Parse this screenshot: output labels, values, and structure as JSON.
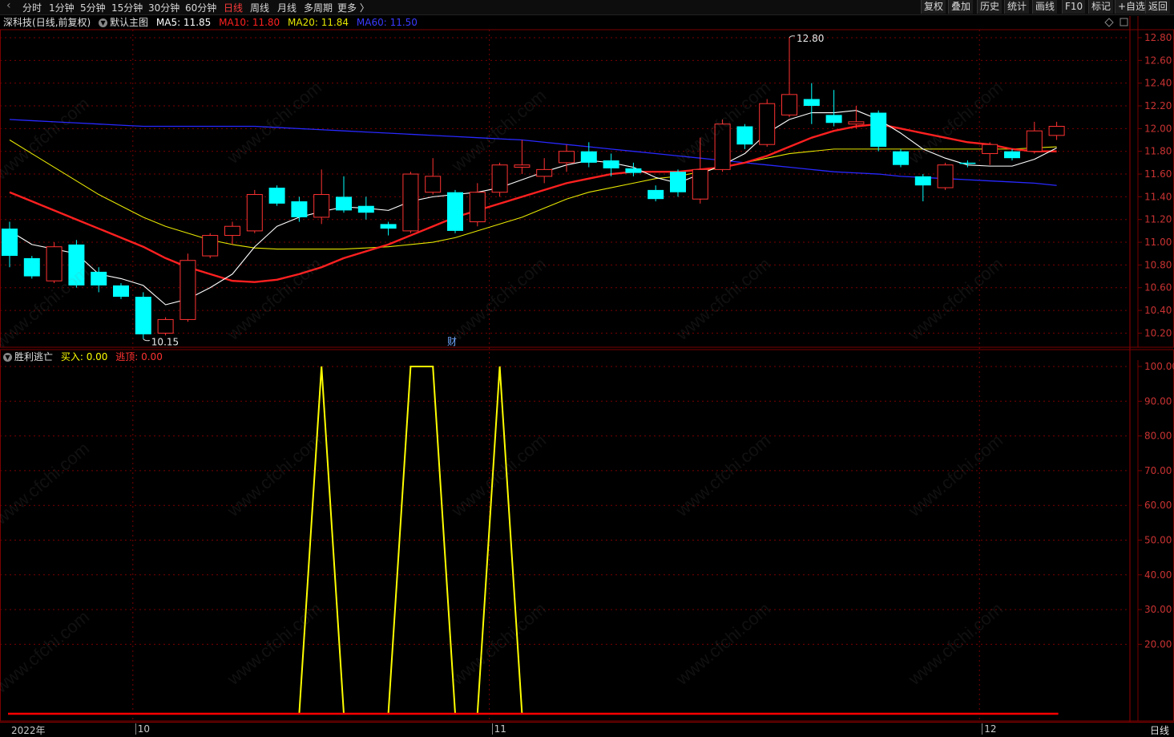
{
  "toolbar": {
    "periods": [
      "分时",
      "1分钟",
      "5分钟",
      "15分钟",
      "30分钟",
      "60分钟",
      "日线",
      "周线",
      "月线",
      "多周期",
      "更多 〉"
    ],
    "active_period": "日线",
    "buttons": [
      "复权",
      "叠加",
      "历史",
      "统计",
      "画线",
      "F10",
      "标记",
      "+自选",
      "返回"
    ]
  },
  "main_info": {
    "stock_name": "深科技",
    "mode": "(日线,前复权)",
    "indicator_name": "默认主图",
    "ma5": "MA5: 11.85",
    "ma10": "MA10: 11.80",
    "ma20": "MA20: 11.84",
    "ma60": "MA60: 11.50"
  },
  "sub_info": {
    "indicator_name": "胜利逃亡",
    "buy": "买入: 0.00",
    "escape": "逃顶: 0.00"
  },
  "colors": {
    "up": "#ff3232",
    "down": "#00ffff",
    "ma5": "#ffffff",
    "ma10": "#ff2020",
    "ma20": "#e6e600",
    "ma60": "#2828ff",
    "indicator_line": "#ffff00",
    "baseline": "#ff0000",
    "grid": "#7a0000"
  },
  "chart_data": [
    {
      "type": "candlestick",
      "title": "深科技 (日线,前复权)",
      "ylim": [
        10.1,
        12.9
      ],
      "y_ticks": [
        "12.80",
        "12.60",
        "12.40",
        "12.20",
        "12.00",
        "11.80",
        "11.60",
        "11.40",
        "11.20",
        "11.00",
        "10.80",
        "10.60",
        "10.40",
        "10.20"
      ],
      "annotations": {
        "high_label": "12.80",
        "low_label": "10.15",
        "event_marker": "财"
      },
      "candles": [
        {
          "o": 11.12,
          "c": 10.88,
          "h": 11.18,
          "l": 10.78
        },
        {
          "o": 10.86,
          "c": 10.7,
          "h": 10.88,
          "l": 10.68
        },
        {
          "o": 10.66,
          "c": 10.96,
          "h": 11.0,
          "l": 10.64
        },
        {
          "o": 10.98,
          "c": 10.62,
          "h": 11.02,
          "l": 10.6
        },
        {
          "o": 10.74,
          "c": 10.62,
          "h": 10.78,
          "l": 10.56
        },
        {
          "o": 10.62,
          "c": 10.52,
          "h": 10.64,
          "l": 10.5
        },
        {
          "o": 10.52,
          "c": 10.19,
          "h": 10.56,
          "l": 10.15
        },
        {
          "o": 10.2,
          "c": 10.32,
          "h": 10.34,
          "l": 10.18
        },
        {
          "o": 10.32,
          "c": 10.84,
          "h": 10.9,
          "l": 10.3
        },
        {
          "o": 10.88,
          "c": 11.06,
          "h": 11.08,
          "l": 10.86
        },
        {
          "o": 11.06,
          "c": 11.14,
          "h": 11.18,
          "l": 10.98
        },
        {
          "o": 11.1,
          "c": 11.42,
          "h": 11.46,
          "l": 11.08
        },
        {
          "o": 11.48,
          "c": 11.34,
          "h": 11.5,
          "l": 11.32
        },
        {
          "o": 11.36,
          "c": 11.22,
          "h": 11.4,
          "l": 11.18
        },
        {
          "o": 11.22,
          "c": 11.42,
          "h": 11.64,
          "l": 11.16
        },
        {
          "o": 11.4,
          "c": 11.28,
          "h": 11.58,
          "l": 11.26
        },
        {
          "o": 11.32,
          "c": 11.26,
          "h": 11.4,
          "l": 11.2
        },
        {
          "o": 11.16,
          "c": 11.12,
          "h": 11.18,
          "l": 11.06
        },
        {
          "o": 11.1,
          "c": 11.6,
          "h": 11.62,
          "l": 11.08
        },
        {
          "o": 11.44,
          "c": 11.58,
          "h": 11.74,
          "l": 11.42
        },
        {
          "o": 11.44,
          "c": 11.1,
          "h": 11.46,
          "l": 11.08
        },
        {
          "o": 11.18,
          "c": 11.44,
          "h": 11.52,
          "l": 11.14
        },
        {
          "o": 11.44,
          "c": 11.68,
          "h": 11.7,
          "l": 11.4
        },
        {
          "o": 11.66,
          "c": 11.68,
          "h": 11.9,
          "l": 11.6
        },
        {
          "o": 11.58,
          "c": 11.64,
          "h": 11.74,
          "l": 11.52
        },
        {
          "o": 11.7,
          "c": 11.8,
          "h": 11.86,
          "l": 11.62
        },
        {
          "o": 11.8,
          "c": 11.7,
          "h": 11.88,
          "l": 11.66
        },
        {
          "o": 11.72,
          "c": 11.65,
          "h": 11.78,
          "l": 11.58
        },
        {
          "o": 11.65,
          "c": 11.61,
          "h": 11.7,
          "l": 11.58
        },
        {
          "o": 11.46,
          "c": 11.38,
          "h": 11.5,
          "l": 11.36
        },
        {
          "o": 11.62,
          "c": 11.44,
          "h": 11.64,
          "l": 11.4
        },
        {
          "o": 11.38,
          "c": 11.64,
          "h": 11.92,
          "l": 11.34
        },
        {
          "o": 11.64,
          "c": 12.04,
          "h": 12.08,
          "l": 11.62
        },
        {
          "o": 12.02,
          "c": 11.86,
          "h": 12.04,
          "l": 11.82
        },
        {
          "o": 11.86,
          "c": 12.22,
          "h": 12.26,
          "l": 11.84
        },
        {
          "o": 12.12,
          "c": 12.3,
          "h": 12.8,
          "l": 12.1
        },
        {
          "o": 12.26,
          "c": 12.2,
          "h": 12.4,
          "l": 12.04
        },
        {
          "o": 12.12,
          "c": 12.05,
          "h": 12.34,
          "l": 12.02
        },
        {
          "o": 12.04,
          "c": 12.06,
          "h": 12.2,
          "l": 12.0
        },
        {
          "o": 12.14,
          "c": 11.84,
          "h": 12.16,
          "l": 11.8
        },
        {
          "o": 11.8,
          "c": 11.68,
          "h": 11.82,
          "l": 11.66
        },
        {
          "o": 11.58,
          "c": 11.5,
          "h": 11.6,
          "l": 11.36
        },
        {
          "o": 11.48,
          "c": 11.68,
          "h": 11.7,
          "l": 11.46
        },
        {
          "o": 11.7,
          "c": 11.69,
          "h": 11.72,
          "l": 11.66
        },
        {
          "o": 11.78,
          "c": 11.86,
          "h": 11.88,
          "l": 11.68
        },
        {
          "o": 11.8,
          "c": 11.74,
          "h": 11.82,
          "l": 11.72
        },
        {
          "o": 11.8,
          "c": 11.98,
          "h": 12.06,
          "l": 11.78
        },
        {
          "o": 11.94,
          "c": 12.02,
          "h": 12.06,
          "l": 11.9
        }
      ],
      "ma5": [
        11.1,
        10.98,
        10.94,
        10.9,
        10.72,
        10.68,
        10.62,
        10.45,
        10.5,
        10.6,
        10.72,
        10.96,
        11.14,
        11.22,
        11.27,
        11.31,
        11.3,
        11.28,
        11.36,
        11.4,
        11.42,
        11.44,
        11.48,
        11.55,
        11.62,
        11.68,
        11.72,
        11.7,
        11.66,
        11.57,
        11.52,
        11.6,
        11.68,
        11.78,
        11.96,
        12.08,
        12.14,
        12.14,
        12.16,
        12.08,
        11.96,
        11.82,
        11.74,
        11.68,
        11.67,
        11.67,
        11.73,
        11.83
      ],
      "ma10": [
        11.44,
        11.36,
        11.28,
        11.2,
        11.12,
        11.04,
        10.96,
        10.86,
        10.78,
        10.72,
        10.66,
        10.65,
        10.67,
        10.72,
        10.78,
        10.86,
        10.92,
        10.98,
        11.06,
        11.14,
        11.22,
        11.28,
        11.34,
        11.4,
        11.46,
        11.52,
        11.56,
        11.6,
        11.62,
        11.62,
        11.62,
        11.64,
        11.66,
        11.7,
        11.76,
        11.84,
        11.92,
        11.98,
        12.02,
        12.04,
        12.0,
        11.96,
        11.92,
        11.88,
        11.86,
        11.82,
        11.8,
        11.8
      ],
      "ma20": [
        11.9,
        11.78,
        11.66,
        11.54,
        11.42,
        11.32,
        11.22,
        11.14,
        11.08,
        11.02,
        10.98,
        10.95,
        10.94,
        10.94,
        10.94,
        10.94,
        10.95,
        10.96,
        10.98,
        11.0,
        11.04,
        11.1,
        11.16,
        11.22,
        11.3,
        11.38,
        11.44,
        11.48,
        11.52,
        11.56,
        11.58,
        11.62,
        11.66,
        11.7,
        11.74,
        11.78,
        11.8,
        11.82,
        11.82,
        11.82,
        11.82,
        11.82,
        11.82,
        11.82,
        11.82,
        11.82,
        11.83,
        11.84
      ],
      "ma60": [
        12.08,
        12.07,
        12.06,
        12.05,
        12.04,
        12.03,
        12.02,
        12.02,
        12.02,
        12.02,
        12.02,
        12.02,
        12.01,
        12.0,
        11.99,
        11.98,
        11.97,
        11.96,
        11.95,
        11.94,
        11.93,
        11.92,
        11.91,
        11.9,
        11.88,
        11.86,
        11.84,
        11.82,
        11.8,
        11.78,
        11.76,
        11.74,
        11.72,
        11.7,
        11.68,
        11.66,
        11.64,
        11.62,
        11.61,
        11.6,
        11.58,
        11.57,
        11.56,
        11.55,
        11.54,
        11.53,
        11.52,
        11.5
      ]
    },
    {
      "type": "line",
      "title": "胜利逃亡",
      "ylim": [
        0,
        102
      ],
      "y_ticks": [
        "100.00",
        "90.00",
        "80.00",
        "70.00",
        "60.00",
        "50.00",
        "40.00",
        "30.00",
        "20.00"
      ],
      "series": [
        {
          "name": "买入",
          "values": [
            0,
            0,
            0,
            0,
            0,
            0,
            0,
            0,
            0,
            0,
            0,
            0,
            0,
            0,
            100,
            0,
            0,
            0,
            100,
            100,
            0,
            0,
            100,
            0,
            0,
            0,
            0,
            0,
            0,
            0,
            0,
            0,
            0,
            0,
            0,
            0,
            0,
            0,
            0,
            0,
            0,
            0,
            0,
            0,
            0,
            0,
            0,
            0
          ]
        },
        {
          "name": "逃顶",
          "values": [
            0,
            0,
            0,
            0,
            0,
            0,
            0,
            0,
            0,
            0,
            0,
            0,
            0,
            0,
            0,
            0,
            0,
            0,
            0,
            0,
            0,
            0,
            0,
            0,
            0,
            0,
            0,
            0,
            0,
            0,
            0,
            0,
            0,
            0,
            0,
            0,
            0,
            0,
            0,
            0,
            0,
            0,
            0,
            0,
            0,
            0,
            0,
            0
          ]
        }
      ]
    }
  ],
  "x_axis": {
    "labels": [
      {
        "text": "2022年",
        "index": 0
      },
      {
        "text": "10",
        "index": 6
      },
      {
        "text": "11",
        "index": 22
      },
      {
        "text": "12",
        "index": 44
      }
    ]
  },
  "status": {
    "period_label": "日线"
  },
  "watermark": "www.cfchi.com"
}
